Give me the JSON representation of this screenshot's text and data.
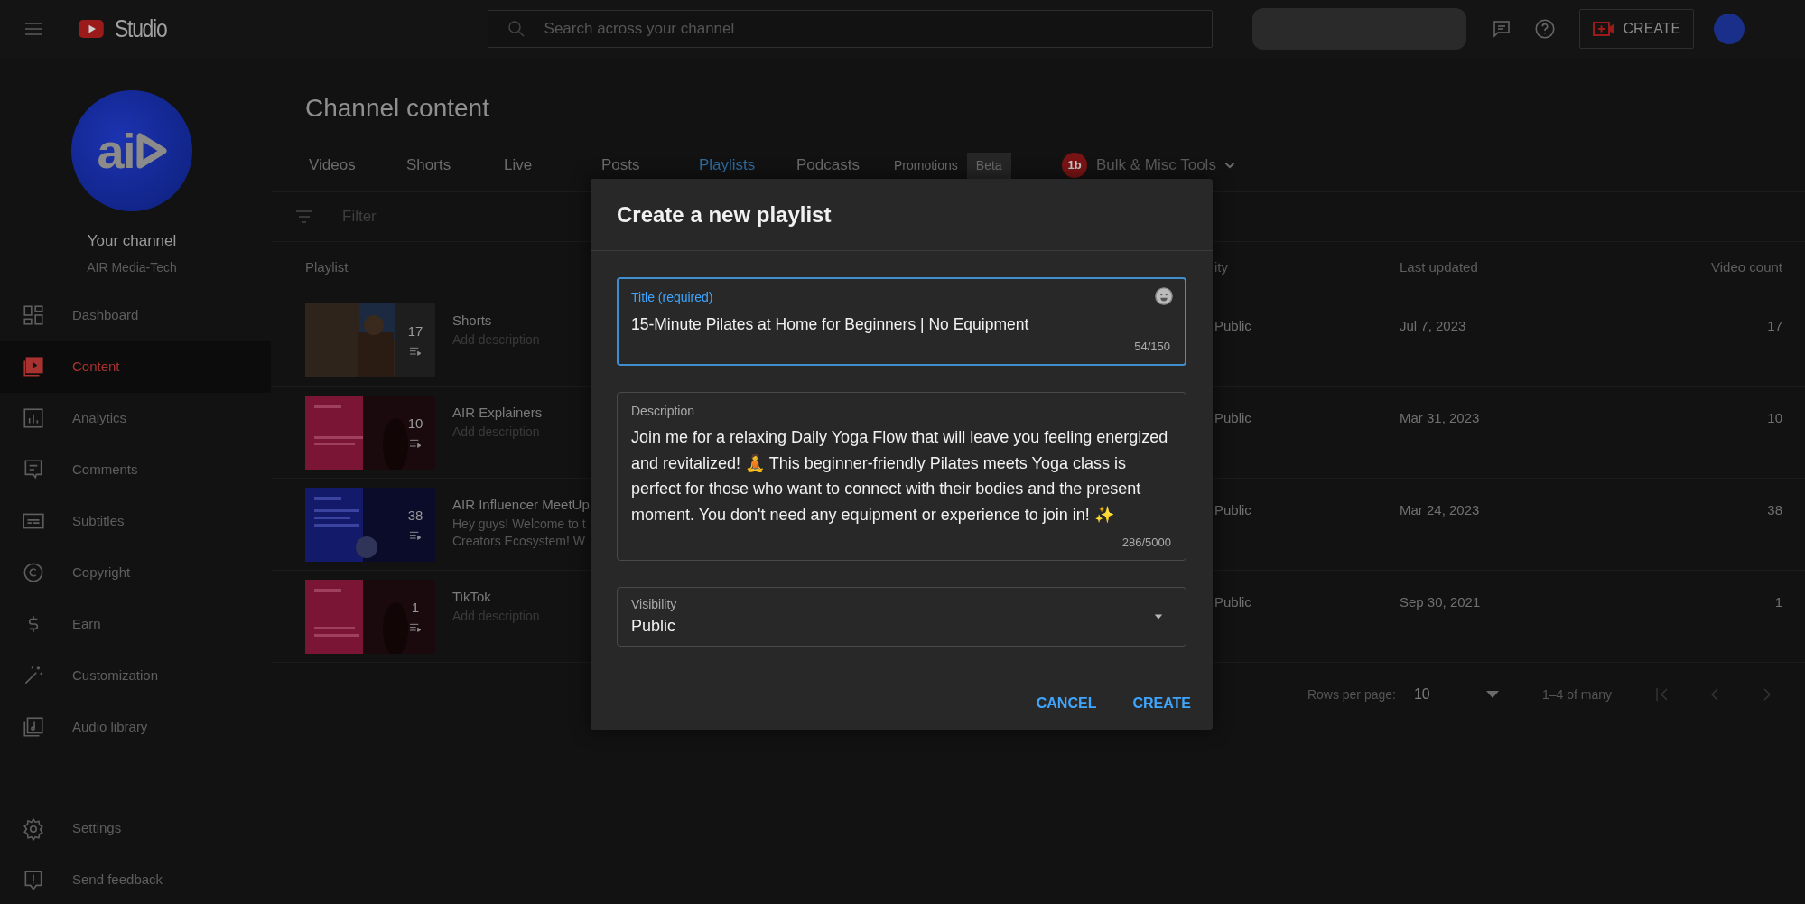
{
  "topbar": {
    "logo_text": "Studio",
    "search": {
      "placeholder": "Search across your channel"
    },
    "create_button": "CREATE"
  },
  "sidebar": {
    "avatar_logo": "ai",
    "channel_label": "Your channel",
    "channel_name": "AIR Media-Tech",
    "items": [
      {
        "label": "Dashboard",
        "selected": false
      },
      {
        "label": "Content",
        "selected": true
      },
      {
        "label": "Analytics",
        "selected": false
      },
      {
        "label": "Comments",
        "selected": false
      },
      {
        "label": "Subtitles",
        "selected": false
      },
      {
        "label": "Copyright",
        "selected": false
      },
      {
        "label": "Earn",
        "selected": false
      },
      {
        "label": "Customization",
        "selected": false
      },
      {
        "label": "Audio library",
        "selected": false
      }
    ],
    "footer_items": [
      {
        "label": "Settings"
      },
      {
        "label": "Send feedback"
      }
    ]
  },
  "page_title": "Channel content",
  "tabs": [
    {
      "label": "Videos",
      "selected": false
    },
    {
      "label": "Shorts",
      "selected": false
    },
    {
      "label": "Live",
      "selected": false
    },
    {
      "label": "Posts",
      "selected": false
    },
    {
      "label": "Playlists",
      "selected": true
    },
    {
      "label": "Podcasts",
      "selected": false
    },
    {
      "label": "Promotions",
      "selected": false,
      "badge": "Beta"
    }
  ],
  "extension": {
    "logo": "1b",
    "label": "Bulk & Misc Tools"
  },
  "filter": {
    "placeholder": "Filter"
  },
  "table": {
    "columns": [
      "Playlist",
      "ity",
      "Last updated",
      "Video count"
    ],
    "rows": [
      {
        "title": "Shorts",
        "description": [
          "Add description"
        ],
        "description_empty": true,
        "count": "17",
        "visibility": "Public",
        "last_updated": "Jul 7, 2023",
        "video_count": "17"
      },
      {
        "title": "AIR Explainers",
        "description": [
          "Add description"
        ],
        "description_empty": true,
        "count": "10",
        "visibility": "Public",
        "last_updated": "Mar 31, 2023",
        "video_count": "10"
      },
      {
        "title": "AIR Influencer MeetUp",
        "description": [
          "Hey guys! Welcome to t",
          "Creators Ecosystem! W"
        ],
        "description_empty": false,
        "count": "38",
        "visibility": "Public",
        "last_updated": "Mar 24, 2023",
        "video_count": "38"
      },
      {
        "title": "TikTok",
        "description": [
          "Add description"
        ],
        "description_empty": true,
        "count": "1",
        "visibility": "Public",
        "last_updated": "Sep 30, 2021",
        "video_count": "1"
      }
    ]
  },
  "pagination": {
    "label": "Rows per page:",
    "rows_per_page": "10",
    "range": "1–4 of many"
  },
  "dialog": {
    "title": "Create a new playlist",
    "title_field": {
      "label": "Title (required)",
      "value": "15-Minute Pilates at Home for Beginners | No Equipment",
      "counter": "54/150",
      "focused": true
    },
    "description_field": {
      "label": "Description",
      "value": "Join me for a relaxing Daily Yoga Flow that will leave you feeling energized and revitalized! 🧘 This beginner-friendly Pilates meets Yoga class is perfect for those who want to connect with their bodies and the present moment. You don't need any equipment or experience to join in! ✨",
      "counter": "286/5000"
    },
    "visibility_field": {
      "label": "Visibility",
      "value": "Public"
    },
    "buttons": [
      "CANCEL",
      "CREATE"
    ]
  }
}
